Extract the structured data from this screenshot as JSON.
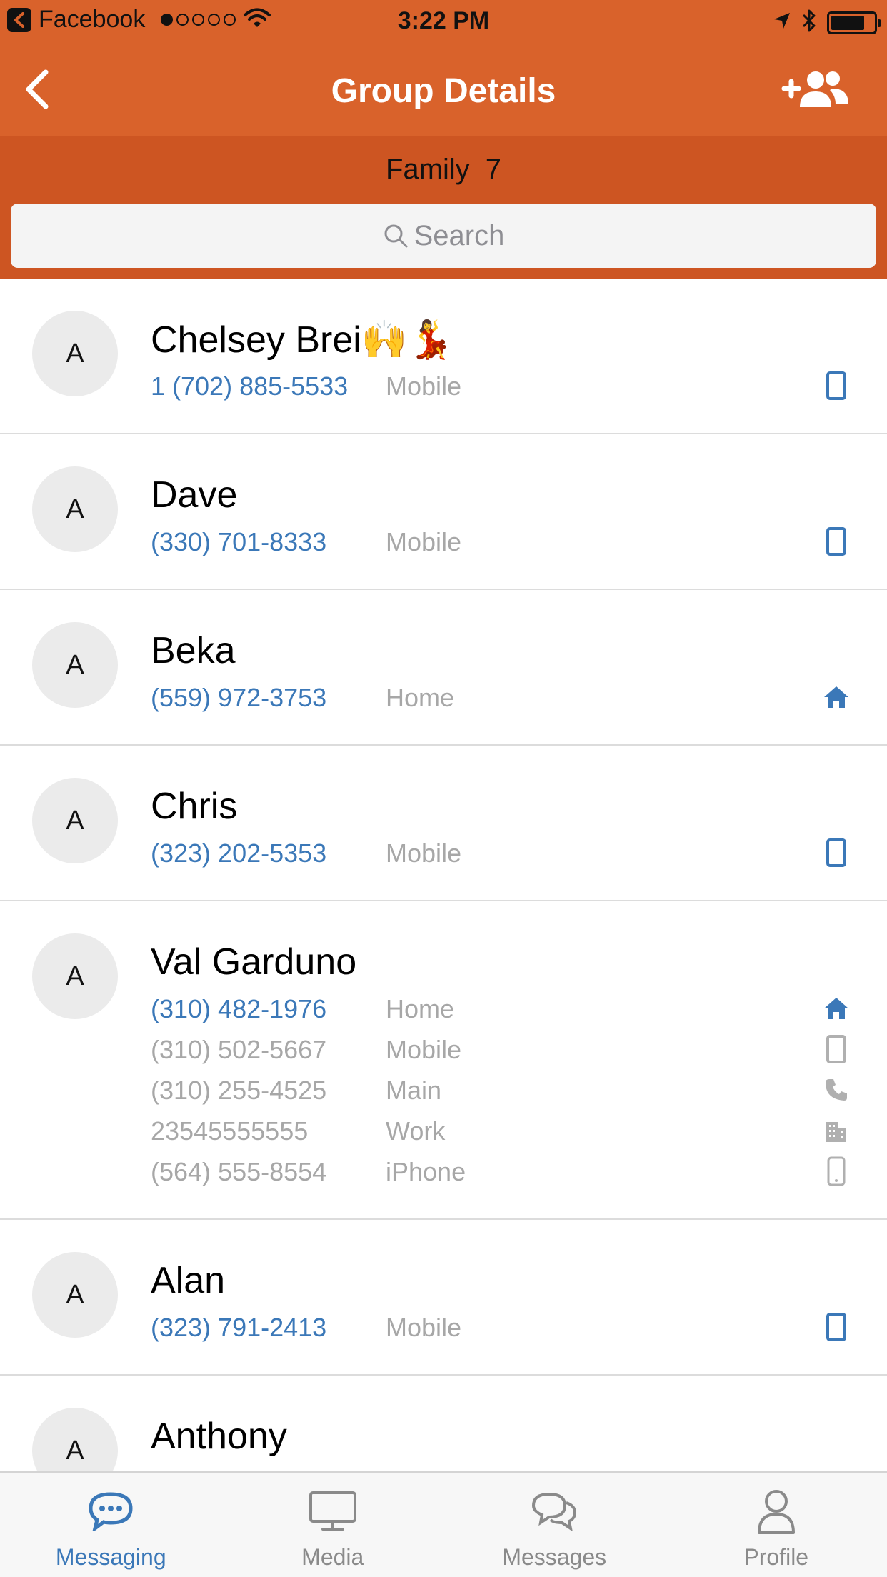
{
  "status_bar": {
    "app_name": "Facebook",
    "time": "3:22 PM",
    "signal_bars": 1,
    "battery_level": 0.8
  },
  "nav": {
    "title": "Group Details",
    "back_icon": "chevron-left-icon",
    "add_icon": "add-contact-icon"
  },
  "group": {
    "name": "Family",
    "count": "7"
  },
  "search": {
    "placeholder": "Search"
  },
  "contacts": [
    {
      "initial": "A",
      "name": "Chelsey Brei🙌💃",
      "phones": [
        {
          "number": "1 (702) 885-5533",
          "type": "Mobile",
          "icon": "mobile-icon",
          "primary": true
        }
      ]
    },
    {
      "initial": "A",
      "name": "Dave",
      "phones": [
        {
          "number": "(330) 701-8333",
          "type": "Mobile",
          "icon": "mobile-icon",
          "primary": true
        }
      ]
    },
    {
      "initial": "A",
      "name": "Beka",
      "phones": [
        {
          "number": "(559) 972-3753",
          "type": "Home",
          "icon": "home-icon",
          "primary": true
        }
      ]
    },
    {
      "initial": "A",
      "name": "Chris",
      "phones": [
        {
          "number": "(323) 202-5353",
          "type": "Mobile",
          "icon": "mobile-icon",
          "primary": true
        }
      ]
    },
    {
      "initial": "A",
      "name": "Val Garduno",
      "phones": [
        {
          "number": "(310) 482-1976",
          "type": "Home",
          "icon": "home-icon",
          "primary": true
        },
        {
          "number": "(310) 502-5667",
          "type": "Mobile",
          "icon": "mobile-icon",
          "primary": false
        },
        {
          "number": "(310) 255-4525",
          "type": "Main",
          "icon": "phone-icon",
          "primary": false
        },
        {
          "number": "23545555555",
          "type": "Work",
          "icon": "building-icon",
          "primary": false
        },
        {
          "number": "(564) 555-8554",
          "type": "iPhone",
          "icon": "iphone-icon",
          "primary": false
        }
      ]
    },
    {
      "initial": "A",
      "name": "Alan",
      "phones": [
        {
          "number": "(323) 791-2413",
          "type": "Mobile",
          "icon": "mobile-icon",
          "primary": true
        }
      ]
    },
    {
      "initial": "A",
      "name": "Anthony",
      "phones": []
    }
  ],
  "tabs": [
    {
      "label": "Messaging",
      "icon": "chat-bubble-icon",
      "active": true
    },
    {
      "label": "Media",
      "icon": "monitor-icon",
      "active": false
    },
    {
      "label": "Messages",
      "icon": "conversation-icon",
      "active": false
    },
    {
      "label": "Profile",
      "icon": "user-icon",
      "active": false
    }
  ],
  "colors": {
    "accent": "#d9622b",
    "group_bar": "#cd5522",
    "link_blue": "#3b78b8",
    "muted_gray": "#a7a7a7"
  }
}
